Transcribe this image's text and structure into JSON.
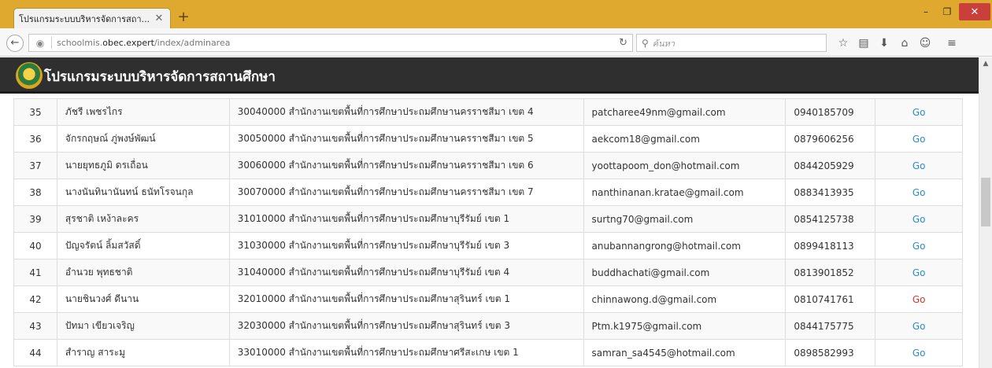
{
  "browser": {
    "tab_title": "โปรแกรมระบบบริหารจัดการสถา...",
    "tab_close": "✕",
    "new_tab": "+",
    "url_prefix": "schoolmis.",
    "url_domain": "obec.expert",
    "url_path": "/index/adminarea",
    "search_placeholder": "ค้นหา",
    "window_controls": {
      "minimize": "–",
      "maximize": "❐",
      "close": "✕"
    }
  },
  "site": {
    "title": "โปรแกรมระบบบริหารจัดการสถานศึกษา"
  },
  "colors": {
    "header_bg": "#2f2f2f",
    "link": "#2a8ccf",
    "link_alert": "#d9362c",
    "titlebar": "#dfa92f"
  },
  "table": {
    "rows": [
      {
        "no": "35",
        "name": "ภัชรี เพชรไกร",
        "area": "30040000 สำนักงานเขตพื้นที่การศึกษาประถมศึกษานครราชสีมา เขต 4",
        "email": "patcharee49nm@gmail.com",
        "phone": "0940185709",
        "action": "Go",
        "alert": false
      },
      {
        "no": "36",
        "name": "จักรกฤษณ์ ภู่พงษ์พัฒน์",
        "area": "30050000 สำนักงานเขตพื้นที่การศึกษาประถมศึกษานครราชสีมา เขต 5",
        "email": "aekcom18@gmail.com",
        "phone": "0879606256",
        "action": "Go",
        "alert": false
      },
      {
        "no": "37",
        "name": "นายยุทธภูมิ ดรเถื่อน",
        "area": "30060000 สำนักงานเขตพื้นที่การศึกษาประถมศึกษานครราชสีมา เขต 6",
        "email": "yoottapoom_don@hotmail.com",
        "phone": "0844205929",
        "action": "Go",
        "alert": false
      },
      {
        "no": "38",
        "name": "นางนันทินานันทน์ ธนัทโรจนกุล",
        "area": "30070000 สำนักงานเขตพื้นที่การศึกษาประถมศึกษานครราชสีมา เขต 7",
        "email": "nanthinanan.kratae@gmail.com",
        "phone": "0883413935",
        "action": "Go",
        "alert": false
      },
      {
        "no": "39",
        "name": "สุรชาติ เหง้าละคร",
        "area": "31010000 สำนักงานเขตพื้นที่การศึกษาประถมศึกษาบุรีรัมย์ เขต 1",
        "email": "surtng70@gmail.com",
        "phone": "0854125738",
        "action": "Go",
        "alert": false
      },
      {
        "no": "40",
        "name": "ปัญจรัตน์ ลิ้มสวัสดิ์",
        "area": "31030000 สำนักงานเขตพื้นที่การศึกษาประถมศึกษาบุรีรัมย์ เขต 3",
        "email": "anubannangrong@hotmail.com",
        "phone": "0899418113",
        "action": "Go",
        "alert": false
      },
      {
        "no": "41",
        "name": "อำนวย พุทธชาติ",
        "area": "31040000 สำนักงานเขตพื้นที่การศึกษาประถมศึกษาบุรีรัมย์ เขต 4",
        "email": "buddhachati@gmail.com",
        "phone": "0813901852",
        "action": "Go",
        "alert": false
      },
      {
        "no": "42",
        "name": "นายชินวงศ์ ดีนาน",
        "area": "32010000 สำนักงานเขตพื้นที่การศึกษาประถมศึกษาสุรินทร์ เขต 1",
        "email": "chinnawong.d@gmail.com",
        "phone": "0810741761",
        "action": "Go",
        "alert": true
      },
      {
        "no": "43",
        "name": "ปัทมา เขียวเจริญ",
        "area": "32030000 สำนักงานเขตพื้นที่การศึกษาประถมศึกษาสุรินทร์ เขต 3",
        "email": "Ptm.k1975@gmail.com",
        "phone": "0844175775",
        "action": "Go",
        "alert": false
      },
      {
        "no": "44",
        "name": "สำราญ สาระมู",
        "area": "33010000 สำนักงานเขตพื้นที่การศึกษาประถมศึกษาศรีสะเกษ เขต 1",
        "email": "samran_sa4545@hotmail.com",
        "phone": "0898582993",
        "action": "Go",
        "alert": false
      }
    ]
  }
}
